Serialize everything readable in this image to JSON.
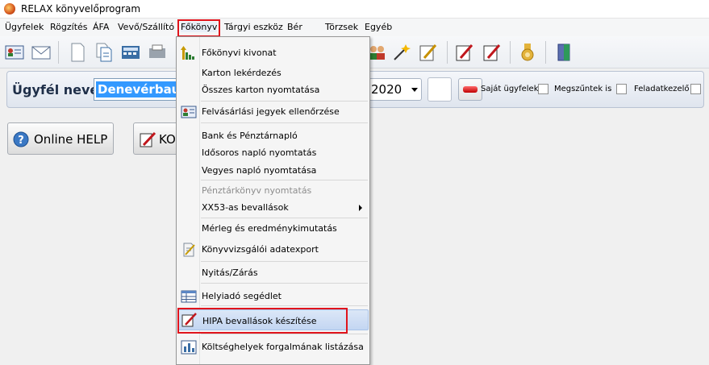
{
  "window": {
    "title": "RELAX könyvelőprogram"
  },
  "menubar": {
    "items": [
      "Ügyfelek",
      "Rögzítés",
      "ÁFA",
      "Vevő/Szállító",
      "Főkönyv",
      "Tárgyi eszköz",
      "Bér",
      "Törzsek",
      "Egyéb"
    ],
    "active": "Főkönyv"
  },
  "toolbar": {
    "icons": [
      "client-card-icon",
      "envelope-icon",
      "document-icon",
      "documents-icon",
      "calculator-icon",
      "printer-icon",
      "people-icon",
      "magic-wand-icon",
      "pencil-note-icon",
      "pencil-red-icon",
      "pencil-red-2-icon",
      "gear-plug-icon",
      "exit-door-icon"
    ]
  },
  "client_panel": {
    "label": "Ügyfél neve:",
    "client_value": "Denevérbau Kft",
    "year": "2020",
    "checkboxes": [
      "Saját ügyfelek",
      "Megszűntek is",
      "Feladatkezelő"
    ]
  },
  "buttons": {
    "help": "Online HELP",
    "ko": "KO"
  },
  "dropdown": {
    "items": [
      {
        "label": "Főkönyvi kivonat",
        "icon": "ledger-chart-icon"
      },
      {
        "label": "Karton lekérdezés"
      },
      {
        "label": "Összes karton nyomtatása"
      },
      {
        "label": "Felvásárlási jegyek ellenőrzése",
        "icon": "id-card-icon"
      },
      {
        "label": "Bank és Pénztárnapló"
      },
      {
        "label": "Idősoros napló nyomtatás"
      },
      {
        "label": "Vegyes napló nyomtatása"
      },
      {
        "label": "Pénztárkönyv nyomtatás",
        "disabled": true
      },
      {
        "label": "XX53-as bevallások",
        "submenu": true
      },
      {
        "label": "Mérleg és eredménykimutatás"
      },
      {
        "label": "Könyvvizsgálói adatexport",
        "icon": "export-doc-icon"
      },
      {
        "label": "Nyitás/Zárás"
      },
      {
        "label": "Helyiadó segédlet",
        "icon": "tax-table-icon"
      },
      {
        "label": "HIPA bevallások készítése",
        "icon": "pencil-form-icon",
        "selected": true
      },
      {
        "label": "Költséghelyek forgalmának listázása",
        "icon": "bar-chart-icon"
      }
    ]
  },
  "colors": {
    "highlight_box": "#e0141c",
    "selection": "#c3d6f2",
    "client_selection": "#3399ff"
  }
}
